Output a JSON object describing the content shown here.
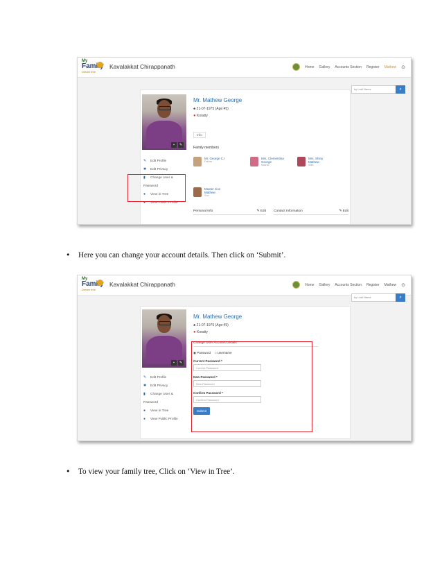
{
  "app": {
    "family_name": "Kavalakkat Chirappanath",
    "logo": {
      "line1": "My",
      "line2": "Family",
      "line3": "Dream tree"
    },
    "nav1": [
      "Home",
      "Gallery",
      "Accounts Section",
      "Register",
      "Mathew"
    ],
    "nav2": [
      "Home",
      "Gallery",
      "Accounts Section",
      "Register",
      "Mathew"
    ],
    "search_placeholder": "by Last Name",
    "search_icon": "magnifier-icon"
  },
  "profile": {
    "name": "Mr. Mathew George",
    "dob": "21-07-1975 (Age:45)",
    "location": "Koratty",
    "info_tab": "Info"
  },
  "sidemenu": {
    "items": [
      "Edit Profile",
      "Edit Privacy",
      "Change User &",
      "Password",
      "View in Tree",
      "View Public Profile"
    ]
  },
  "family_members": {
    "title": "Family members",
    "members": [
      {
        "name": "Mr. George C.I",
        "relation": "Father"
      },
      {
        "name": "Mrs. Clementina George",
        "relation": "Mother"
      },
      {
        "name": "Mrs. Shiny Mathew",
        "relation": "Wife"
      },
      {
        "name": "Master Jion Mathew",
        "relation": "Son"
      }
    ]
  },
  "sections": {
    "personal_info": "Personal Info",
    "contact_info": "Contact Information",
    "edit": "Edit"
  },
  "form": {
    "title": "Change User Account Details",
    "radio_password": "Password",
    "radio_username": "Username",
    "current_label": "Current Password *",
    "current_placeholder": "Current Password",
    "new_label": "New Password *",
    "new_placeholder": "New Password",
    "confirm_label": "Confirm Password *",
    "confirm_placeholder": "Confirm Password",
    "submit": "Submit"
  },
  "document": {
    "bullet1": "Here you can change your account details. Then click on ‘Submit’.",
    "bullet2": "To view your family tree, Click on ‘View in Tree’."
  }
}
